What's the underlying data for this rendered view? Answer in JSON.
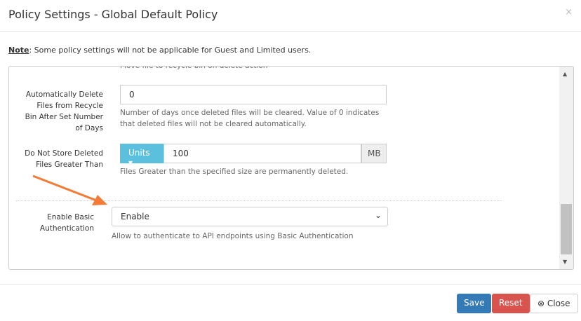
{
  "title": "Policy Settings - Global Default Policy",
  "close_x": "×",
  "note": {
    "bold": "Note",
    "text": ": Some policy settings will not be applicable for Guest and Limited users."
  },
  "cut_help": "Move file to recycle bin on delete action",
  "fields": [
    {
      "label": "Automatically Delete Files from Recycle Bin After Set Number of Days",
      "value": "0",
      "help": "Number of days once deleted files will be cleared. Value of 0 indicates that deleted files will not be cleared automatically."
    },
    {
      "label": "Do Not Store Deleted Files Greater Than",
      "units": "Units ▾",
      "value": "100",
      "suffix": "MB",
      "help": "Files Greater than the specified size are permanently deleted."
    },
    {
      "label": "Enable Basic Authentication",
      "value": "Enable",
      "help": "Allow to authenticate to API endpoints using Basic Authentication"
    }
  ],
  "buttons": {
    "save": "Save",
    "reset": "Reset",
    "close": "Close"
  },
  "colors": {
    "save": "#337ab7",
    "reset": "#d9534f",
    "units": "#5bc0de",
    "arrow": "#f47b36"
  }
}
